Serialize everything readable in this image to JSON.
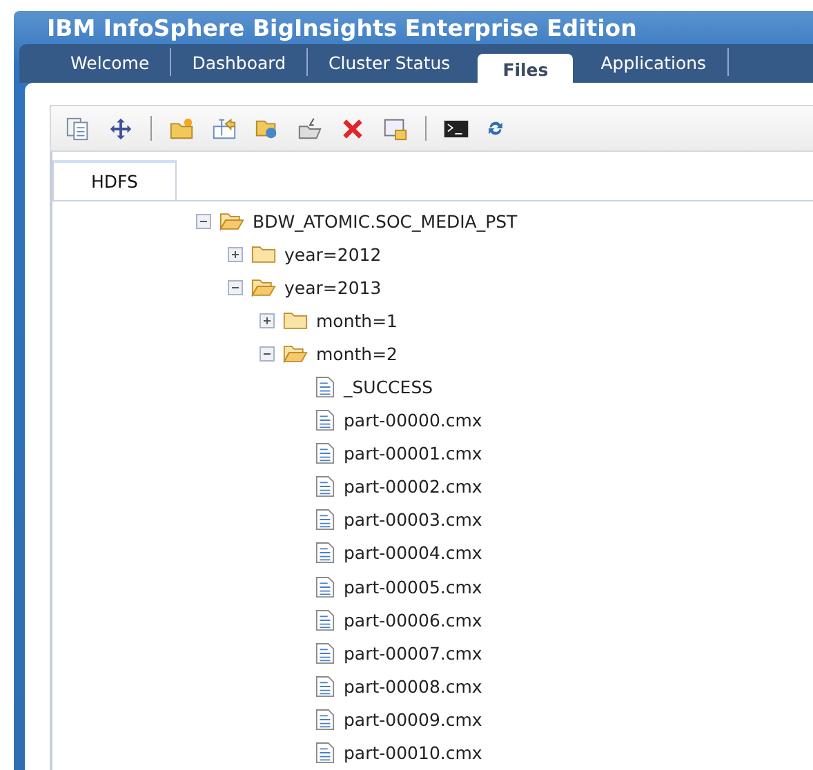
{
  "window": {
    "title": "IBM InfoSphere BigInsights Enterprise Edition"
  },
  "tabs": [
    {
      "label": "Welcome",
      "selected": false
    },
    {
      "label": "Dashboard",
      "selected": false
    },
    {
      "label": "Cluster Status",
      "selected": false
    },
    {
      "label": "Files",
      "selected": true
    },
    {
      "label": "Applications",
      "selected": false
    }
  ],
  "panel_tabs": [
    {
      "label": "HDFS",
      "selected": true
    }
  ],
  "tree": [
    {
      "label": "BDW_ATOMIC.SOC_MEDIA_PST",
      "kind": "folder",
      "expanded": true,
      "children": [
        {
          "label": "year=2012",
          "kind": "folder",
          "expanded": false
        },
        {
          "label": "year=2013",
          "kind": "folder",
          "expanded": true,
          "children": [
            {
              "label": "month=1",
              "kind": "folder",
              "expanded": false
            },
            {
              "label": "month=2",
              "kind": "folder",
              "expanded": true,
              "children": [
                {
                  "label": "_SUCCESS",
                  "kind": "file"
                },
                {
                  "label": "part-00000.cmx",
                  "kind": "file"
                },
                {
                  "label": "part-00001.cmx",
                  "kind": "file"
                },
                {
                  "label": "part-00002.cmx",
                  "kind": "file"
                },
                {
                  "label": "part-00003.cmx",
                  "kind": "file"
                },
                {
                  "label": "part-00004.cmx",
                  "kind": "file"
                },
                {
                  "label": "part-00005.cmx",
                  "kind": "file"
                },
                {
                  "label": "part-00006.cmx",
                  "kind": "file"
                },
                {
                  "label": "part-00007.cmx",
                  "kind": "file"
                },
                {
                  "label": "part-00008.cmx",
                  "kind": "file"
                },
                {
                  "label": "part-00009.cmx",
                  "kind": "file"
                },
                {
                  "label": "part-00010.cmx",
                  "kind": "file"
                }
              ]
            }
          ]
        }
      ]
    }
  ]
}
